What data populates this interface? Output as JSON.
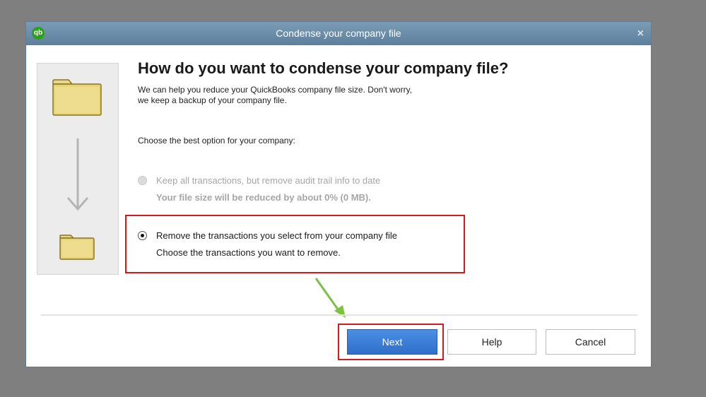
{
  "dialog": {
    "title": "Condense your company file",
    "logo_text": "qb",
    "close_glyph": "×"
  },
  "content": {
    "heading": "How do you want to condense your company file?",
    "intro_line1": "We can help you reduce your QuickBooks company file size. Don't worry,",
    "intro_line2": "we keep a backup of your company file.",
    "choose_label": "Choose the best option for your company:"
  },
  "options": [
    {
      "line1": "Keep all transactions, but remove audit trail info to date",
      "line2": "Your file size will be reduced by about 0% (0 MB).",
      "state": "disabled"
    },
    {
      "line1": "Remove the transactions you select from your company file",
      "line2": "Choose the transactions you want to remove.",
      "state": "selected"
    }
  ],
  "buttons": {
    "next": "Next",
    "help": "Help",
    "cancel": "Cancel"
  },
  "icons": [
    "qb-logo-icon",
    "close-icon",
    "folder-icon",
    "arrow-down-icon",
    "radio-icon",
    "annotation-arrow-icon"
  ],
  "colors": {
    "titlebar": "#6a8ba8",
    "highlight_red": "#d01b20",
    "next_blue": "#3a7bd5",
    "annotation_green": "#7dc142",
    "folder_yellow": "#e6d47a"
  }
}
